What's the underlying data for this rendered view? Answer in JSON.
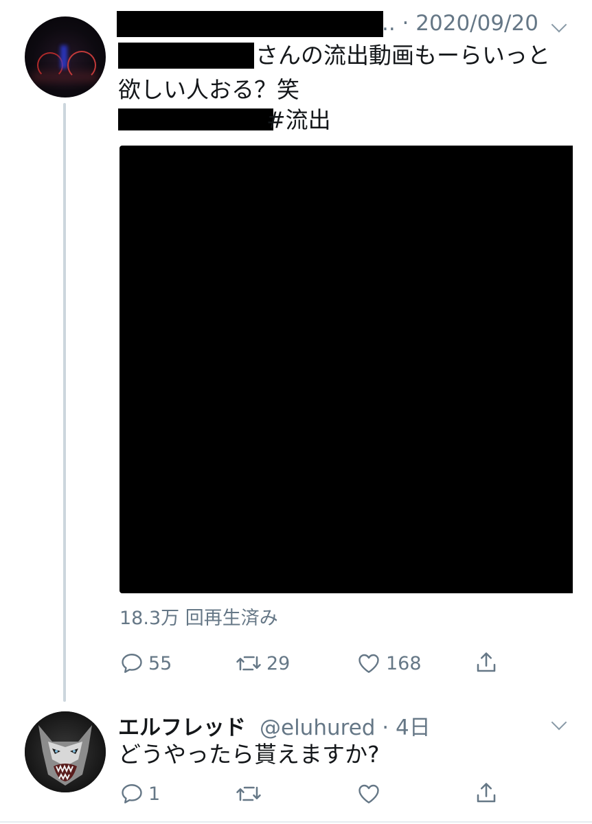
{
  "tweet": {
    "meta_suffix": ".. · 2020/09/20",
    "line1": "さんの流出動画もーらいっと",
    "line2": "欲しい人おる？笑",
    "hashtag": "#流出",
    "views": "18.3万 回再生済み",
    "actions": {
      "reply_count": "55",
      "retweet_count": "29",
      "like_count": "168"
    }
  },
  "reply": {
    "display_name": "エルフレッド",
    "handle_time": "@eluhured · 4日",
    "text": "どうやったら貰えますか?",
    "actions": {
      "reply_count": "1",
      "retweet_count": "",
      "like_count": ""
    }
  },
  "colors": {
    "text": "#14171a",
    "muted": "#657786",
    "thread_line": "#ccd6dd",
    "redaction": "#000000"
  }
}
